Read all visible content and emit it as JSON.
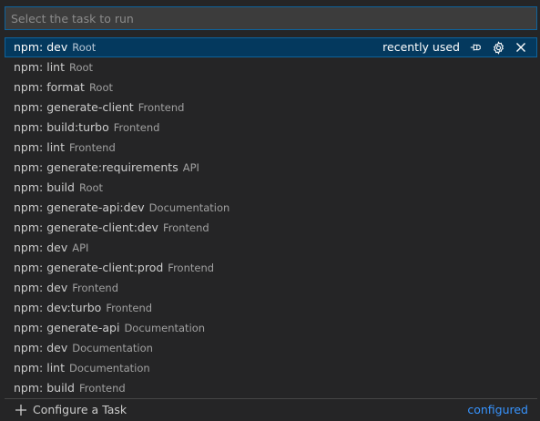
{
  "search": {
    "placeholder": "Select the task to run",
    "value": ""
  },
  "colors": {
    "background": "#252526",
    "selected_row": "#04395e",
    "focus_border": "#0e639c",
    "link": "#3794ff"
  },
  "selected_actions": {
    "recently_used": "recently used",
    "icons": [
      "pin-icon",
      "gear-icon",
      "close-icon"
    ]
  },
  "tasks": [
    {
      "label": "npm: dev",
      "desc": "Root"
    },
    {
      "label": "npm: lint",
      "desc": "Root"
    },
    {
      "label": "npm: format",
      "desc": "Root"
    },
    {
      "label": "npm: generate-client",
      "desc": "Frontend"
    },
    {
      "label": "npm: build:turbo",
      "desc": "Frontend"
    },
    {
      "label": "npm: lint",
      "desc": "Frontend"
    },
    {
      "label": "npm: generate:requirements",
      "desc": "API"
    },
    {
      "label": "npm: build",
      "desc": "Root"
    },
    {
      "label": "npm: generate-api:dev",
      "desc": "Documentation"
    },
    {
      "label": "npm: generate-client:dev",
      "desc": "Frontend"
    },
    {
      "label": "npm: dev",
      "desc": "API"
    },
    {
      "label": "npm: generate-client:prod",
      "desc": "Frontend"
    },
    {
      "label": "npm: dev",
      "desc": "Frontend"
    },
    {
      "label": "npm: dev:turbo",
      "desc": "Frontend"
    },
    {
      "label": "npm: generate-api",
      "desc": "Documentation"
    },
    {
      "label": "npm: dev",
      "desc": "Documentation"
    },
    {
      "label": "npm: lint",
      "desc": "Documentation"
    },
    {
      "label": "npm: build",
      "desc": "Frontend"
    }
  ],
  "footer": {
    "configure_label": "Configure a Task",
    "group_label": "configured"
  }
}
